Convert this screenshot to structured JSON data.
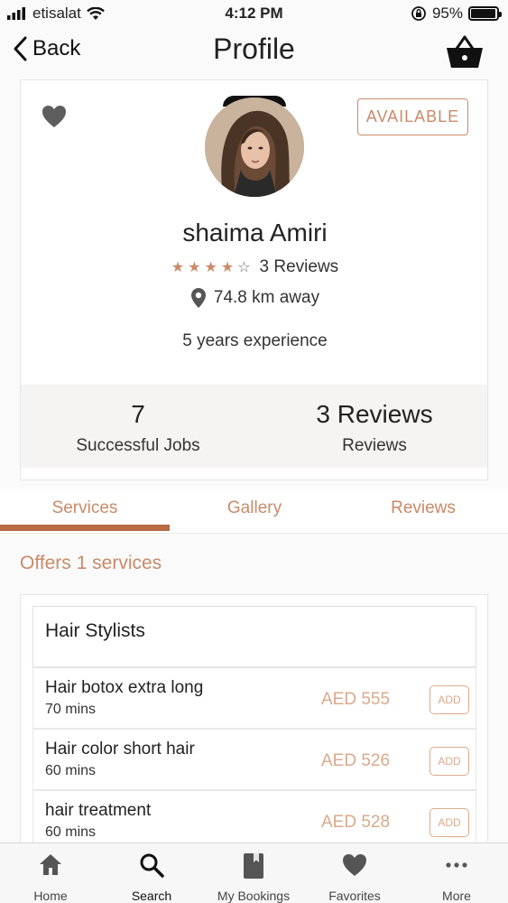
{
  "status_bar": {
    "carrier": "etisalat",
    "time": "4:12 PM",
    "battery": "95%",
    "battery_level": 0.95
  },
  "nav": {
    "back_label": "Back",
    "title": "Profile"
  },
  "profile": {
    "availability": "AVAILABLE",
    "name": "shaima Amiri",
    "rating": 4,
    "rating_max": 5,
    "reviews_text": "3 Reviews",
    "distance": "74.8 km away",
    "experience": "5 years experience",
    "stats": {
      "jobs_value": "7",
      "jobs_label": "Successful Jobs",
      "reviews_value": "3 Reviews",
      "reviews_label": "Reviews"
    }
  },
  "tabs": {
    "services": "Services",
    "gallery": "Gallery",
    "reviews": "Reviews",
    "active": "services"
  },
  "services": {
    "offers_title": "Offers 1 services",
    "category": "Hair Stylists",
    "items": [
      {
        "name": "Hair botox extra long",
        "duration": "70 mins",
        "price": "AED 555",
        "add_label": "ADD"
      },
      {
        "name": "Hair color short hair",
        "duration": "60 mins",
        "price": "AED 526",
        "add_label": "ADD"
      },
      {
        "name": "hair treatment",
        "duration": "60 mins",
        "price": "AED 528",
        "add_label": "ADD"
      }
    ]
  },
  "tab_bar": {
    "items": [
      {
        "label": "Home",
        "icon": "home-icon"
      },
      {
        "label": "Search",
        "icon": "search-icon"
      },
      {
        "label": "My Bookings",
        "icon": "book-icon"
      },
      {
        "label": "Favorites",
        "icon": "heart-icon"
      },
      {
        "label": "More",
        "icon": "more-icon"
      }
    ],
    "active": "Search"
  },
  "colors": {
    "accent": "#c98a68",
    "accent_dark": "#b86a43",
    "price": "#d9a98c"
  }
}
